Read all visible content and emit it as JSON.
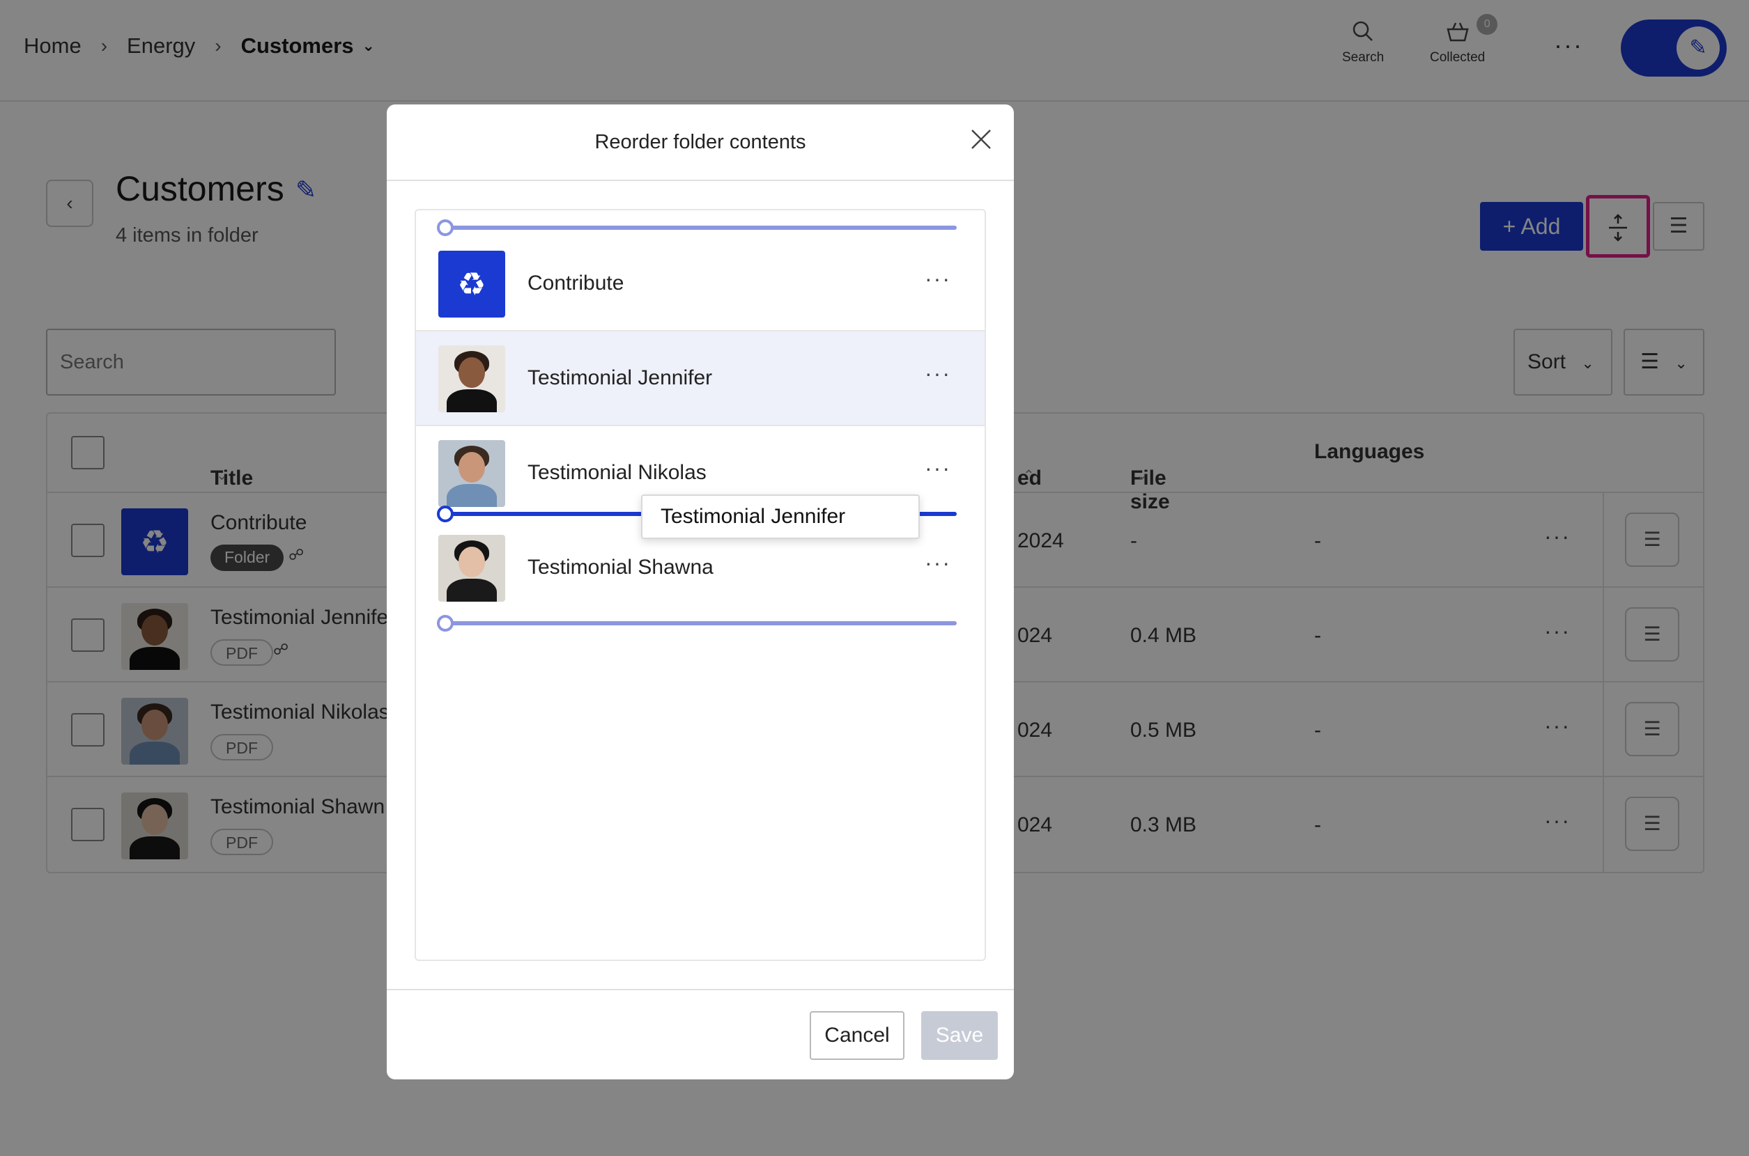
{
  "breadcrumb": {
    "home": "Home",
    "sep1": "›",
    "energy": "Energy",
    "sep2": "›",
    "current": "Customers"
  },
  "top_actions": {
    "search_label": "Search",
    "collected_label": "Collected",
    "collected_count": "0",
    "more": "···"
  },
  "page": {
    "title": "Customers",
    "subtitle": "4 items in folder",
    "add_label": "+ Add",
    "back": "‹"
  },
  "toolbar": {
    "search_placeholder": "Search",
    "sort_label": "Sort"
  },
  "table": {
    "headers": {
      "title": "Title",
      "modified": "ed",
      "file_size": "File size",
      "languages": "Languages"
    },
    "rows": [
      {
        "title": "Contribute",
        "tag": "Folder",
        "date": "2024",
        "size": "-",
        "lang": "-",
        "more": "···"
      },
      {
        "title": "Testimonial Jennife",
        "tag": "PDF",
        "date": "024",
        "size": "0.4 MB",
        "lang": "-",
        "more": "···"
      },
      {
        "title": "Testimonial Nikolas",
        "tag": "PDF",
        "date": "024",
        "size": "0.5 MB",
        "lang": "-",
        "more": "···"
      },
      {
        "title": "Testimonial Shawn",
        "tag": "PDF",
        "date": "024",
        "size": "0.3 MB",
        "lang": "-",
        "more": "···"
      }
    ]
  },
  "modal": {
    "title": "Reorder folder contents",
    "items": [
      {
        "label": "Contribute",
        "more": "···"
      },
      {
        "label": "Testimonial Jennifer",
        "more": "···"
      },
      {
        "label": "Testimonial Nikolas",
        "more": "···"
      },
      {
        "label": "Testimonial Shawna",
        "more": "···"
      }
    ],
    "drag_ghost": "Testimonial Jennifer",
    "cancel_label": "Cancel",
    "save_label": "Save"
  },
  "colors": {
    "brand": "#1b3ad1",
    "highlight": "#e0218a",
    "drop_line_light": "#8c96e0"
  },
  "icons": [
    "search-icon",
    "basket-icon",
    "edit-pencil-icon",
    "reorder-icon",
    "settings-sliders-icon",
    "close-icon",
    "recycle-icon",
    "share-icon"
  ]
}
